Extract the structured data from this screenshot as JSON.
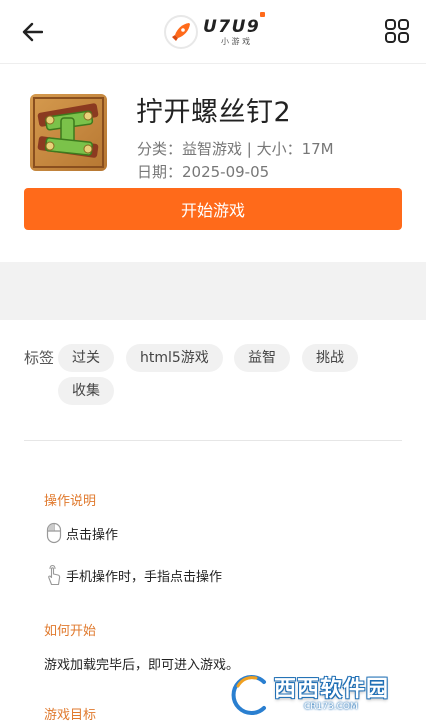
{
  "header": {
    "back_icon": "arrow-left-icon",
    "logo_text": "U7U9",
    "logo_sub": "小 游 戏",
    "grid_icon": "grid-menu-icon"
  },
  "game": {
    "title": "拧开螺丝钉2",
    "category_size": "分类：益智游戏 | 大小：17M",
    "date": "日期：2025-09-05",
    "start_label": "开始游戏"
  },
  "tags": {
    "label": "标签",
    "items": [
      "过关",
      "html5游戏",
      "益智",
      "挑战",
      "收集"
    ]
  },
  "instructions": {
    "operation_title": "操作说明",
    "click_text": "点击操作",
    "mobile_text": "手机操作时，手指点击操作",
    "how_title": "如何开始",
    "how_text": "游戏加载完毕后，即可进入游戏。",
    "goal_title": "游戏目标"
  },
  "watermark": {
    "main": "西西软件园",
    "sub": "CR173.COM"
  },
  "colors": {
    "accent": "#ff6a1a",
    "section_title": "#e07a2e",
    "tag_bg": "#f1f1f1",
    "band_bg": "#f2f2f2"
  }
}
